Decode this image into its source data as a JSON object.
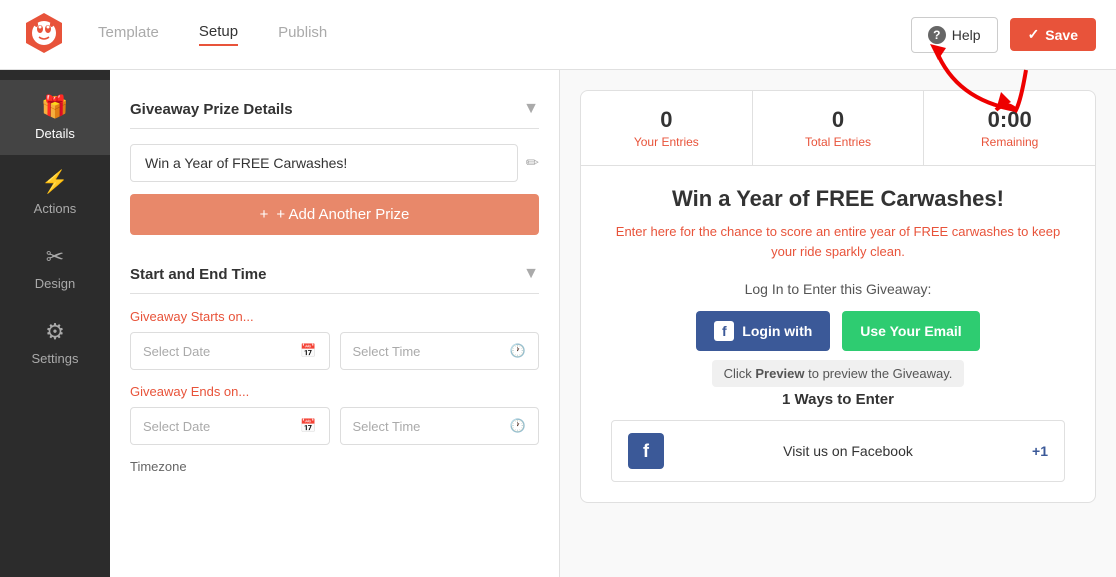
{
  "topnav": {
    "tabs": [
      {
        "id": "template",
        "label": "Template",
        "active": false
      },
      {
        "id": "setup",
        "label": "Setup",
        "active": true
      },
      {
        "id": "publish",
        "label": "Publish",
        "active": false
      }
    ],
    "help_label": "Help",
    "save_label": "Save"
  },
  "sidebar": {
    "items": [
      {
        "id": "details",
        "label": "Details",
        "icon": "🎁",
        "active": true
      },
      {
        "id": "actions",
        "label": "Actions",
        "icon": "⚡",
        "active": false
      },
      {
        "id": "design",
        "label": "Design",
        "icon": "✂",
        "active": false
      },
      {
        "id": "settings",
        "label": "Settings",
        "icon": "⚙",
        "active": false
      }
    ]
  },
  "left_panel": {
    "prize_section": {
      "title": "Giveaway Prize Details",
      "prize_value": "Win a Year of FREE Carwashes!",
      "add_prize_label": "+ Add Another Prize"
    },
    "time_section": {
      "title": "Start and End Time",
      "starts_label": "Giveaway Starts on...",
      "ends_label": "Giveaway Ends on...",
      "start_date_placeholder": "Select Date",
      "start_time_placeholder": "Select Time",
      "end_date_placeholder": "Select Date",
      "end_time_placeholder": "Select Time",
      "timezone_label": "Timezone"
    }
  },
  "preview": {
    "stats": [
      {
        "value": "0",
        "label": "Your Entries"
      },
      {
        "value": "0",
        "label": "Total Entries"
      },
      {
        "value": "0:00",
        "label": "Remaining"
      }
    ],
    "title": "Win a Year of FREE Carwashes!",
    "description_plain": "Enter here for the chance to score an entire year of ",
    "description_highlight": "FREE carwashes",
    "description_end": " to keep your ride sparkly clean.",
    "login_label": "Log In to Enter this Giveaway:",
    "login_with_label": "Login with",
    "use_email_label": "Use Your Email",
    "preview_tip_plain": "Click ",
    "preview_tip_bold": "Preview",
    "preview_tip_end": " to preview the Giveaway.",
    "ways_to_enter": "1 Ways to Enter",
    "entry_row": {
      "text": "Visit us on Facebook",
      "plus": "+1"
    }
  }
}
